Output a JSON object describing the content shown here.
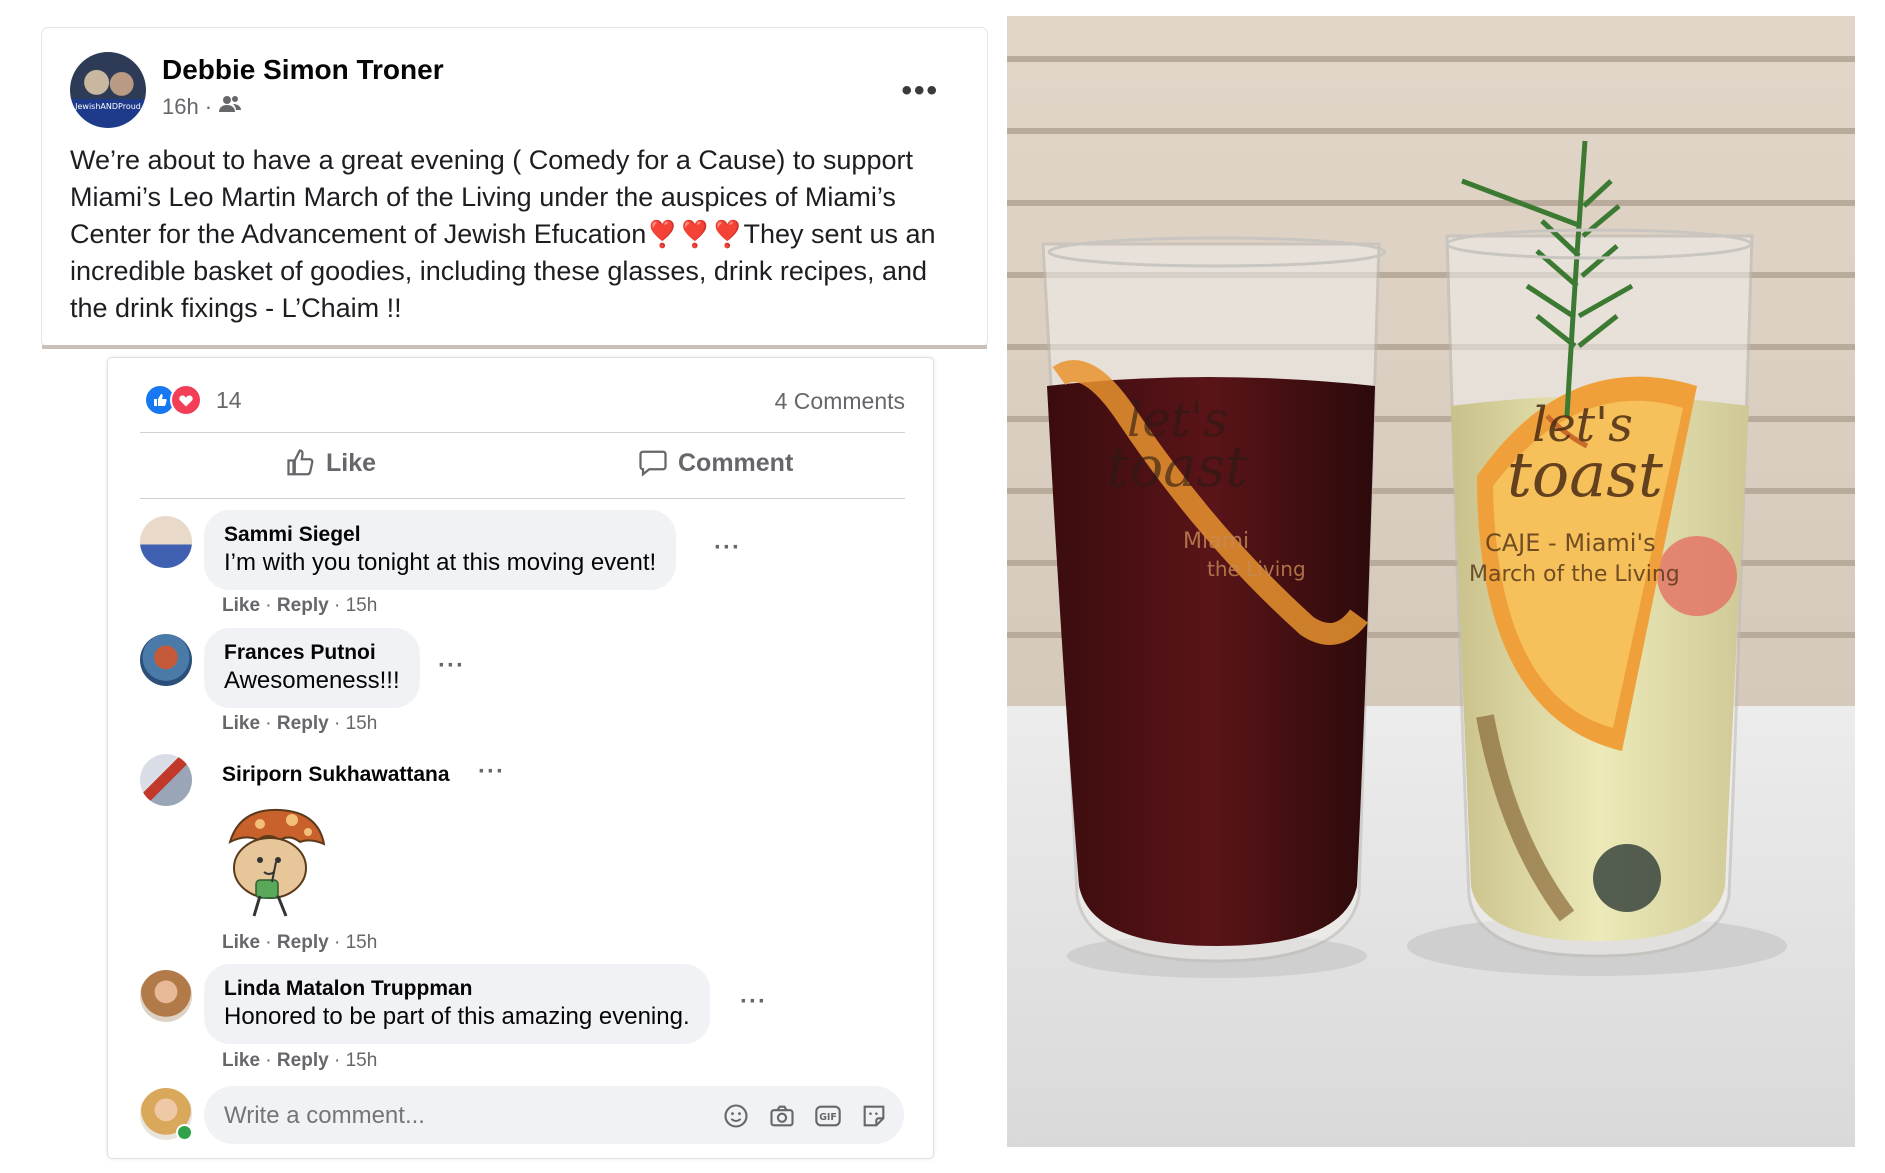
{
  "post": {
    "author": "Debbie Simon Troner",
    "time": "16h",
    "audience_icon": "friends-icon",
    "avatar_band": "JewishANDProud",
    "text_part1": "We’re about to have a great evening ( Comedy for a Cause) to support Miami’s Leo Martin March of the Living under the auspices of Miami’s Center for the Advancement of Jewish Efucation",
    "text_part2": "They sent us an incredible basket of goodies, including these glasses, drink recipes, and the drink fixings - L’Chaim !!",
    "hearts": "❣️❣️❣️"
  },
  "reactions": {
    "count": "14",
    "comments": "4 Comments",
    "like_color": "#1877f2",
    "love_color": "#f33e58"
  },
  "actions": {
    "like": "Like",
    "comment": "Comment"
  },
  "comments": [
    {
      "name": "Sammi Siegel",
      "text": "I’m with you tonight at this moving event!",
      "like": "Like",
      "reply": "Reply",
      "time": "15h"
    },
    {
      "name": "Frances Putnoi",
      "text": "Awesomeness!!!",
      "like": "Like",
      "reply": "Reply",
      "time": "15h"
    },
    {
      "name": "Siriporn Sukhawattana",
      "text": "",
      "like": "Like",
      "reply": "Reply",
      "time": "15h"
    },
    {
      "name": "Linda Matalon Truppman",
      "text": "Honored to be part of this amazing evening.",
      "like": "Like",
      "reply": "Reply",
      "time": "15h"
    }
  ],
  "composer": {
    "placeholder": "Write a comment..."
  },
  "photo": {
    "left_glass_text": [
      "let's",
      "toast",
      "Miami",
      "the Living"
    ],
    "right_glass_text": [
      "let's",
      "toast",
      "CAJE - Miami's",
      "March of the Living"
    ]
  }
}
